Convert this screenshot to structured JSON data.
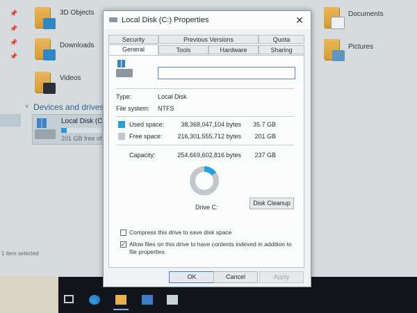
{
  "explorer": {
    "folders": [
      {
        "label": "3D Objects",
        "overlay": "cube-icon"
      },
      {
        "label": "Downloads",
        "overlay": "arrow-down-icon"
      },
      {
        "label": "Videos",
        "overlay": "film-icon"
      },
      {
        "label": "Documents",
        "overlay": "document-icon"
      },
      {
        "label": "Pictures",
        "overlay": "picture-icon"
      }
    ],
    "section_title": "Devices and drives",
    "drive": {
      "name": "Local Disk (C:)",
      "free_text": "201 GB free of",
      "used_fraction": 0.14
    },
    "status_text": "1 item selected"
  },
  "dialog": {
    "title": "Local Disk (C:) Properties",
    "close_glyph": "✕",
    "tabs_top": [
      "Security",
      "Previous Versions",
      "Quota"
    ],
    "tabs_bottom": [
      "General",
      "Tools",
      "Hardware",
      "Sharing"
    ],
    "active_tab": "General",
    "drive_label_value": "",
    "type_label": "Type:",
    "type_value": "Local Disk",
    "fs_label": "File system:",
    "fs_value": "NTFS",
    "used_label": "Used space:",
    "used_bytes": "38,368,047,104 bytes",
    "used_gb": "35.7 GB",
    "free_label": "Free space:",
    "free_bytes": "216,301,555,712 bytes",
    "free_gb": "201 GB",
    "capacity_label": "Capacity:",
    "capacity_bytes": "254,669,602,816 bytes",
    "capacity_gb": "237 GB",
    "drive_caption": "Drive C:",
    "cleanup_label": "Disk Cleanup",
    "compress_label": "Compress this drive to save disk space",
    "compress_checked": false,
    "index_label": "Allow files on this drive to have contents indexed in addition to file properties",
    "index_checked": true,
    "ok_label": "OK",
    "cancel_label": "Cancel",
    "apply_label": "Apply",
    "used_fraction": 0.1507,
    "colors": {
      "used": "#26a0da",
      "free": "#bfc8ce"
    }
  }
}
